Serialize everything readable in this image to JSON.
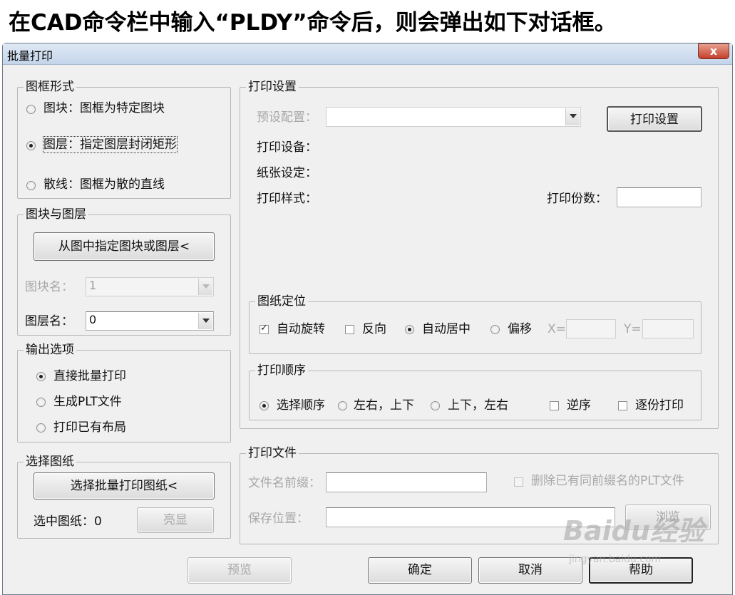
{
  "headline": "在CAD命令栏中输入“PLDY”命令后，则会弹出如下对话框。",
  "dialog": {
    "title": "批量打印",
    "close": "x"
  },
  "frame_style": {
    "legend": "图框形式",
    "options": [
      {
        "label": "图块：图框为特定图块",
        "selected": false
      },
      {
        "label": "图层：指定图层封闭矩形",
        "selected": true
      },
      {
        "label": "散线：图框为散的直线",
        "selected": false
      }
    ]
  },
  "block_layer": {
    "legend": "图块与图层",
    "pick_button": "从图中指定图块或图层<",
    "block_label": "图块名：",
    "block_value": "1",
    "layer_label": "图层名：",
    "layer_value": "0"
  },
  "output": {
    "legend": "输出选项",
    "options": [
      {
        "label": "直接批量打印",
        "selected": true
      },
      {
        "label": "生成PLT文件",
        "selected": false
      },
      {
        "label": "打印已有布局",
        "selected": false
      }
    ]
  },
  "select_paper": {
    "legend": "选择图纸",
    "select_button": "选择批量打印图纸<",
    "selected_label": "选中图纸：0",
    "highlight_button": "亮显"
  },
  "print_settings": {
    "legend": "打印设置",
    "preset_label": "预设配置：",
    "preset_value": "",
    "settings_button": "打印设置",
    "device_label": "打印设备：",
    "paper_label": "纸张设定：",
    "style_label": "打印样式：",
    "copies_label": "打印份数：",
    "copies_value": ""
  },
  "paper_position": {
    "legend": "图纸定位",
    "auto_rotate": "自动旋转",
    "auto_rotate_checked": true,
    "reverse": "反向",
    "reverse_checked": false,
    "auto_center": "自动居中",
    "auto_center_selected": true,
    "offset": "偏移",
    "offset_selected": false,
    "x_label": "X=",
    "y_label": "Y=",
    "x_value": "",
    "y_value": ""
  },
  "print_order": {
    "legend": "打印顺序",
    "order_select": "选择顺序",
    "order_lr_tb": "左右，上下",
    "order_tb_lr": "上下，左右",
    "selected_index": 0,
    "reverse": "逆序",
    "reverse_checked": false,
    "copy_by_copy": "逐份打印",
    "copy_by_copy_checked": false
  },
  "print_file": {
    "legend": "打印文件",
    "prefix_label": "文件名前缀：",
    "prefix_value": "",
    "delete_label": "删除已有同前缀名的PLT文件",
    "delete_checked": false,
    "save_label": "保存位置：",
    "save_value": "",
    "browse_button": "浏览"
  },
  "footer": {
    "preview": "预览",
    "ok": "确定",
    "cancel": "取消",
    "help": "帮助"
  },
  "watermark": {
    "logo": "Baidu经验",
    "sub": "jingyan.baidu.com"
  }
}
